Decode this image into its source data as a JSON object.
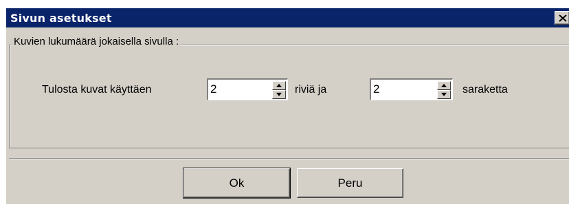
{
  "dialog": {
    "title": "Sivun asetukset",
    "close_icon": "close-icon"
  },
  "group": {
    "label": "Kuvien lukumäärä jokaisella sivulla :"
  },
  "layout_row": {
    "prefix": "Tulosta kuvat käyttäen",
    "rows_value": "2",
    "middle": "riviä ja",
    "columns_value": "2",
    "suffix": "saraketta"
  },
  "buttons": {
    "ok": "Ok",
    "cancel": "Peru"
  },
  "colors": {
    "titlebar": "#0a246a",
    "face": "#d4d0c8"
  }
}
